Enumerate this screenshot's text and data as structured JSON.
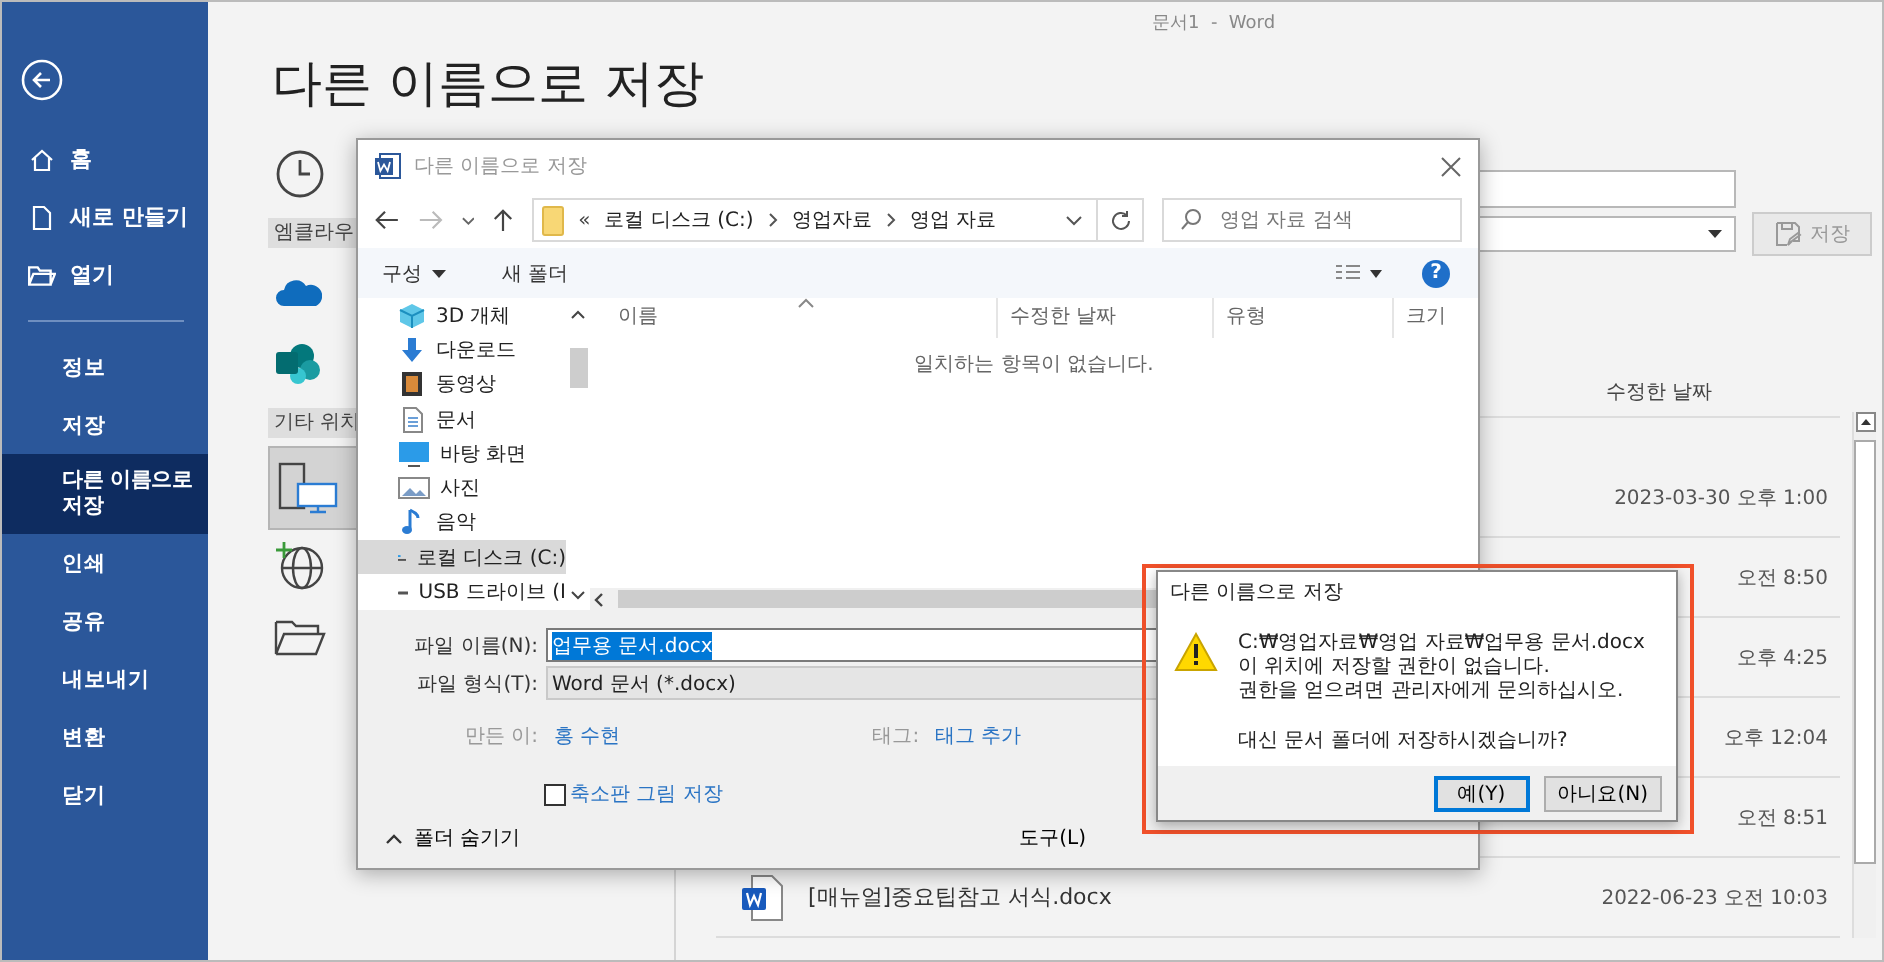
{
  "app": {
    "title": "문서1  -  Word"
  },
  "sidebar": {
    "primary": [
      {
        "label": "홈",
        "selected": false
      },
      {
        "label": "새로 만들기",
        "selected": false
      },
      {
        "label": "열기",
        "selected": false
      }
    ],
    "secondary": [
      {
        "label": "정보",
        "selected": false
      },
      {
        "label": "저장",
        "selected": false
      },
      {
        "label": "다른 이름으로 저장",
        "selected": true
      },
      {
        "label": "인쇄",
        "selected": false
      },
      {
        "label": "공유",
        "selected": false
      },
      {
        "label": "내보내기",
        "selected": false
      },
      {
        "label": "변환",
        "selected": false
      },
      {
        "label": "닫기",
        "selected": false
      }
    ]
  },
  "page": {
    "heading": "다른 이름으로 저장"
  },
  "locations": [
    {
      "kind": "recent",
      "selected": false
    },
    {
      "kind": "header",
      "label": "엠클라우"
    },
    {
      "kind": "onedrive",
      "selected": false
    },
    {
      "kind": "sharepoint",
      "selected": false
    },
    {
      "kind": "header",
      "label": "기타 위치"
    },
    {
      "kind": "pc",
      "selected": true
    },
    {
      "kind": "web",
      "selected": false
    },
    {
      "kind": "browse",
      "selected": false
    }
  ],
  "save_panel": {
    "save_button": {
      "label": "저장",
      "disabled": true
    },
    "column": "수정한 날짜",
    "rows": [
      {
        "modified": "2023-03-30 오후 1:00"
      },
      {
        "modified": "오전 8:50"
      },
      {
        "modified": "오후 4:25"
      },
      {
        "modified": "오후 12:04"
      },
      {
        "modified": "오전 8:51"
      },
      {
        "name": "[매뉴얼]중요팁참고 서식.docx",
        "modified": "2022-06-23 오전 10:03"
      }
    ]
  },
  "file_dialog": {
    "title": "다른 이름으로 저장",
    "overflow_mark": "«",
    "path": [
      "로컬 디스크 (C:)",
      "영업자료",
      "영업 자료"
    ],
    "search": {
      "placeholder": "영업 자료 검색"
    },
    "toolbar": {
      "organize": "구성",
      "new_folder": "새 폴더",
      "help": "?"
    },
    "nav": [
      {
        "label": "3D 개체",
        "selected": false
      },
      {
        "label": "다운로드",
        "selected": false
      },
      {
        "label": "동영상",
        "selected": false
      },
      {
        "label": "문서",
        "selected": false
      },
      {
        "label": "바탕 화면",
        "selected": false
      },
      {
        "label": "사진",
        "selected": false
      },
      {
        "label": "음악",
        "selected": false
      },
      {
        "label": "로컬 디스크 (C:)",
        "selected": true
      },
      {
        "label": "USB 드라이브 (I",
        "selected": false
      }
    ],
    "columns": [
      "이름",
      "수정한 날짜",
      "유형",
      "크기"
    ],
    "empty_message": "일치하는 항목이 없습니다.",
    "file_name": {
      "label": "파일 이름(N):",
      "value": "업무용 문서.docx",
      "selected": true
    },
    "file_type": {
      "label": "파일 형식(T):",
      "value": "Word 문서 (*.docx)"
    },
    "authors": {
      "label": "만든 이:",
      "value": "홍 수현"
    },
    "tags": {
      "label": "태그:",
      "value": "태그 추가"
    },
    "thumbnail": {
      "label": "축소판 그림 저장",
      "checked": false
    },
    "hide_folders": "폴더 숨기기",
    "tools": "도구(L)"
  },
  "alert": {
    "title": "다른 이름으로 저장",
    "highlighted": true,
    "message": [
      "C:₩영업자료₩영업 자료₩업무용 문서.docx",
      "이 위치에 저장할 권한이 없습니다.",
      "권한을 얻으려면 관리자에게 문의하십시오."
    ],
    "question": "대신 문서 폴더에 저장하시겠습니까?",
    "buttons": [
      {
        "label": "예(Y)",
        "default": true
      },
      {
        "label": "아니요(N)",
        "default": false
      }
    ]
  }
}
